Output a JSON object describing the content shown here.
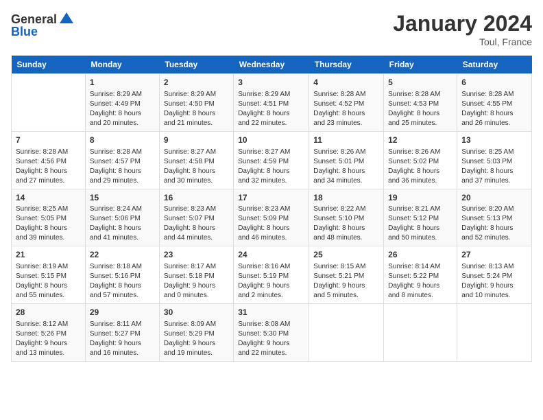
{
  "logo": {
    "general": "General",
    "blue": "Blue"
  },
  "title": "January 2024",
  "location": "Toul, France",
  "days_header": [
    "Sunday",
    "Monday",
    "Tuesday",
    "Wednesday",
    "Thursday",
    "Friday",
    "Saturday"
  ],
  "weeks": [
    [
      {
        "day": "",
        "info": ""
      },
      {
        "day": "1",
        "info": "Sunrise: 8:29 AM\nSunset: 4:49 PM\nDaylight: 8 hours\nand 20 minutes."
      },
      {
        "day": "2",
        "info": "Sunrise: 8:29 AM\nSunset: 4:50 PM\nDaylight: 8 hours\nand 21 minutes."
      },
      {
        "day": "3",
        "info": "Sunrise: 8:29 AM\nSunset: 4:51 PM\nDaylight: 8 hours\nand 22 minutes."
      },
      {
        "day": "4",
        "info": "Sunrise: 8:28 AM\nSunset: 4:52 PM\nDaylight: 8 hours\nand 23 minutes."
      },
      {
        "day": "5",
        "info": "Sunrise: 8:28 AM\nSunset: 4:53 PM\nDaylight: 8 hours\nand 25 minutes."
      },
      {
        "day": "6",
        "info": "Sunrise: 8:28 AM\nSunset: 4:55 PM\nDaylight: 8 hours\nand 26 minutes."
      }
    ],
    [
      {
        "day": "7",
        "info": "Sunrise: 8:28 AM\nSunset: 4:56 PM\nDaylight: 8 hours\nand 27 minutes."
      },
      {
        "day": "8",
        "info": "Sunrise: 8:28 AM\nSunset: 4:57 PM\nDaylight: 8 hours\nand 29 minutes."
      },
      {
        "day": "9",
        "info": "Sunrise: 8:27 AM\nSunset: 4:58 PM\nDaylight: 8 hours\nand 30 minutes."
      },
      {
        "day": "10",
        "info": "Sunrise: 8:27 AM\nSunset: 4:59 PM\nDaylight: 8 hours\nand 32 minutes."
      },
      {
        "day": "11",
        "info": "Sunrise: 8:26 AM\nSunset: 5:01 PM\nDaylight: 8 hours\nand 34 minutes."
      },
      {
        "day": "12",
        "info": "Sunrise: 8:26 AM\nSunset: 5:02 PM\nDaylight: 8 hours\nand 36 minutes."
      },
      {
        "day": "13",
        "info": "Sunrise: 8:25 AM\nSunset: 5:03 PM\nDaylight: 8 hours\nand 37 minutes."
      }
    ],
    [
      {
        "day": "14",
        "info": "Sunrise: 8:25 AM\nSunset: 5:05 PM\nDaylight: 8 hours\nand 39 minutes."
      },
      {
        "day": "15",
        "info": "Sunrise: 8:24 AM\nSunset: 5:06 PM\nDaylight: 8 hours\nand 41 minutes."
      },
      {
        "day": "16",
        "info": "Sunrise: 8:23 AM\nSunset: 5:07 PM\nDaylight: 8 hours\nand 44 minutes."
      },
      {
        "day": "17",
        "info": "Sunrise: 8:23 AM\nSunset: 5:09 PM\nDaylight: 8 hours\nand 46 minutes."
      },
      {
        "day": "18",
        "info": "Sunrise: 8:22 AM\nSunset: 5:10 PM\nDaylight: 8 hours\nand 48 minutes."
      },
      {
        "day": "19",
        "info": "Sunrise: 8:21 AM\nSunset: 5:12 PM\nDaylight: 8 hours\nand 50 minutes."
      },
      {
        "day": "20",
        "info": "Sunrise: 8:20 AM\nSunset: 5:13 PM\nDaylight: 8 hours\nand 52 minutes."
      }
    ],
    [
      {
        "day": "21",
        "info": "Sunrise: 8:19 AM\nSunset: 5:15 PM\nDaylight: 8 hours\nand 55 minutes."
      },
      {
        "day": "22",
        "info": "Sunrise: 8:18 AM\nSunset: 5:16 PM\nDaylight: 8 hours\nand 57 minutes."
      },
      {
        "day": "23",
        "info": "Sunrise: 8:17 AM\nSunset: 5:18 PM\nDaylight: 9 hours\nand 0 minutes."
      },
      {
        "day": "24",
        "info": "Sunrise: 8:16 AM\nSunset: 5:19 PM\nDaylight: 9 hours\nand 2 minutes."
      },
      {
        "day": "25",
        "info": "Sunrise: 8:15 AM\nSunset: 5:21 PM\nDaylight: 9 hours\nand 5 minutes."
      },
      {
        "day": "26",
        "info": "Sunrise: 8:14 AM\nSunset: 5:22 PM\nDaylight: 9 hours\nand 8 minutes."
      },
      {
        "day": "27",
        "info": "Sunrise: 8:13 AM\nSunset: 5:24 PM\nDaylight: 9 hours\nand 10 minutes."
      }
    ],
    [
      {
        "day": "28",
        "info": "Sunrise: 8:12 AM\nSunset: 5:26 PM\nDaylight: 9 hours\nand 13 minutes."
      },
      {
        "day": "29",
        "info": "Sunrise: 8:11 AM\nSunset: 5:27 PM\nDaylight: 9 hours\nand 16 minutes."
      },
      {
        "day": "30",
        "info": "Sunrise: 8:09 AM\nSunset: 5:29 PM\nDaylight: 9 hours\nand 19 minutes."
      },
      {
        "day": "31",
        "info": "Sunrise: 8:08 AM\nSunset: 5:30 PM\nDaylight: 9 hours\nand 22 minutes."
      },
      {
        "day": "",
        "info": ""
      },
      {
        "day": "",
        "info": ""
      },
      {
        "day": "",
        "info": ""
      }
    ]
  ]
}
